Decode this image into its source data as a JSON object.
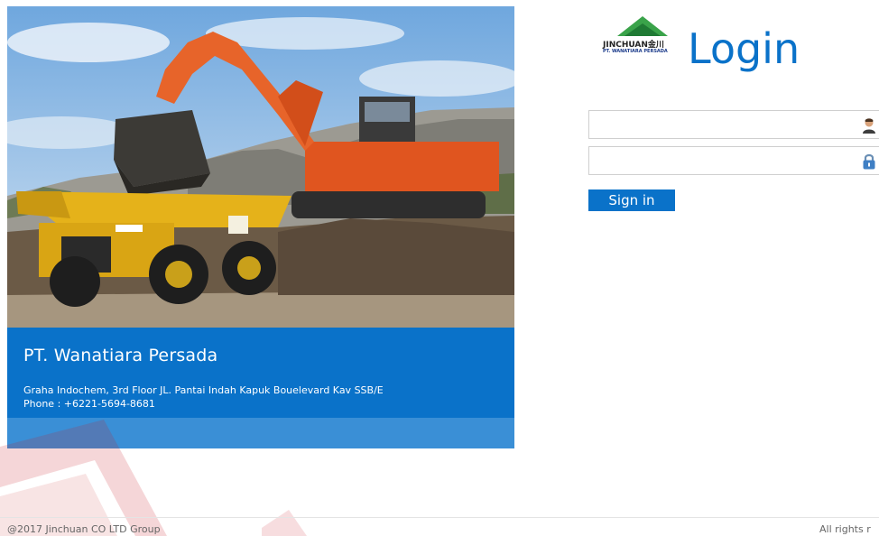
{
  "hero": {
    "company": "PT. Wanatiara Persada",
    "address": "Graha Indochem, 3rd Floor JL. Pantai Indah Kapuk Bouelevard Kav SSB/E",
    "phone": "Phone : +6221-5694-8681"
  },
  "logo": {
    "name": "JINCHUAN金川",
    "sub": "PT. WANATIARA PERSADA"
  },
  "login": {
    "title": "Login",
    "username_value": "",
    "password_value": "",
    "signin_label": "Sign in"
  },
  "footer": {
    "copyright": "@2017 Jinchuan CO LTD Group",
    "rights": "All rights r"
  },
  "colors": {
    "accent": "#0a72c9",
    "strip": "#3a8fd6",
    "watermark": "#c81d25"
  }
}
